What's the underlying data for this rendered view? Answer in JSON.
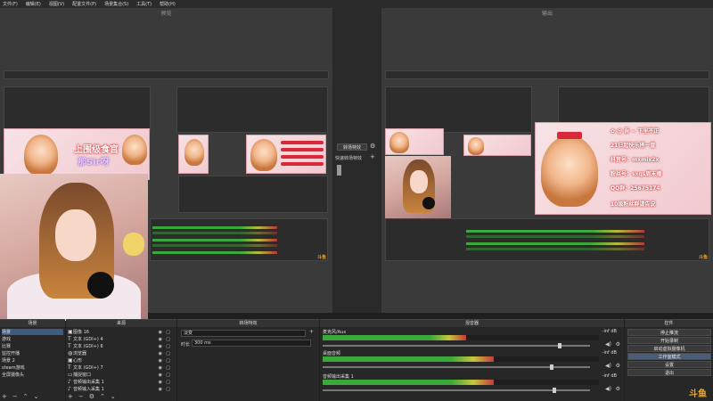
{
  "menu": [
    "文件(F)",
    "编辑(E)",
    "视图(V)",
    "配置文件(P)",
    "场景集合(S)",
    "工具(T)",
    "帮助(H)"
  ],
  "preview": {
    "title": "预览"
  },
  "program": {
    "title": "输出"
  },
  "transition_panel": {
    "button": "转场特效",
    "preset": "快速转场特效"
  },
  "overlay_left": {
    "line1": "上围级食官",
    "line2": "那Sir呀"
  },
  "overlay_right": {
    "lines": [
      "✿ @ 吾 ~ 下里不正",
      "21日起快乐搭一直",
      "抖音号：mxmix2x",
      "粉丝号：sxqs周末播",
      "QQ群：25675174",
      "10级粉丝群请告说"
    ]
  },
  "scenes": {
    "title": "场景",
    "items": [
      "场景",
      "游戏",
      "比赛",
      "监控开播",
      "场景 2",
      "steam游戏",
      "全屏摄像头"
    ],
    "selected": 0
  },
  "sources": {
    "title": "来源",
    "items": [
      {
        "icon": "image-icon",
        "label": "图像 16"
      },
      {
        "icon": "text-icon",
        "label": "文本 (GDI+) 4"
      },
      {
        "icon": "text-icon",
        "label": "文本 (GDI+) 6"
      },
      {
        "icon": "browser-icon",
        "label": "浏览器"
      },
      {
        "icon": "image-icon",
        "label": "心形"
      },
      {
        "icon": "text-icon",
        "label": "文本 (GDI+) 7"
      },
      {
        "icon": "capture-icon",
        "label": "捕捉窗口"
      },
      {
        "icon": "audio-icon",
        "label": "音频输出采集 1"
      },
      {
        "icon": "audio-icon",
        "label": "音频输入采集 1"
      }
    ]
  },
  "transitions": {
    "title": "转场特效",
    "type": "淡变",
    "duration_label": "时长",
    "duration_value": "300 ms"
  },
  "mixer": {
    "title": "混音器",
    "tracks": [
      {
        "name": "麦克风/Aux",
        "db": "-inf dB",
        "fill": 0.52,
        "knob": 0.88
      },
      {
        "name": "桌面音频",
        "db": "-inf dB",
        "fill": 0.62,
        "knob": 0.85
      },
      {
        "name": "音频输出采集 1",
        "db": "-inf dB",
        "fill": 0.62,
        "knob": 0.86
      }
    ]
  },
  "controls": {
    "title": "控件",
    "buttons": [
      "停止推流",
      "开始录制",
      "启动虚拟摄像机",
      "工作室模式",
      "设置",
      "退出"
    ],
    "active": 3
  },
  "watermark": "斗鱼",
  "colors": {
    "accent": "#3d5a80",
    "meter_green": "#3aa83a",
    "meter_red": "#c63a3a",
    "douyu": "#f5a623"
  }
}
